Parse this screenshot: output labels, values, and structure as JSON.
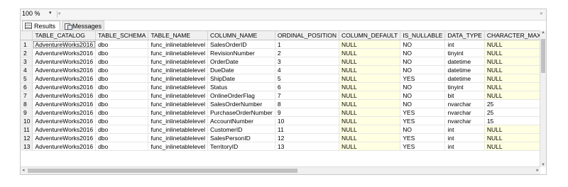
{
  "toolbar": {
    "zoom": "100 %",
    "zoom_arrow": "▾",
    "scroll_left": "◂",
    "scroll_right": "▸"
  },
  "tabs": {
    "results": "Results",
    "messages": "Messages"
  },
  "grid": {
    "headers": [
      "",
      "TABLE_CATALOG",
      "TABLE_SCHEMA",
      "TABLE_NAME",
      "COLUMN_NAME",
      "ORDINAL_POSITION",
      "COLUMN_DEFAULT",
      "IS_NULLABLE",
      "DATA_TYPE",
      "CHARACTER_MAXIM"
    ],
    "rows": [
      [
        "1",
        "AdventureWorks2016",
        "dbo",
        "func_inlinetablelevel",
        "SalesOrderID",
        "1",
        "NULL",
        "NO",
        "int",
        "NULL"
      ],
      [
        "2",
        "AdventureWorks2016",
        "dbo",
        "func_inlinetablelevel",
        "RevisionNumber",
        "2",
        "NULL",
        "NO",
        "tinyint",
        "NULL"
      ],
      [
        "3",
        "AdventureWorks2016",
        "dbo",
        "func_inlinetablelevel",
        "OrderDate",
        "3",
        "NULL",
        "NO",
        "datetime",
        "NULL"
      ],
      [
        "4",
        "AdventureWorks2016",
        "dbo",
        "func_inlinetablelevel",
        "DueDate",
        "4",
        "NULL",
        "NO",
        "datetime",
        "NULL"
      ],
      [
        "5",
        "AdventureWorks2016",
        "dbo",
        "func_inlinetablelevel",
        "ShipDate",
        "5",
        "NULL",
        "YES",
        "datetime",
        "NULL"
      ],
      [
        "6",
        "AdventureWorks2016",
        "dbo",
        "func_inlinetablelevel",
        "Status",
        "6",
        "NULL",
        "NO",
        "tinyint",
        "NULL"
      ],
      [
        "7",
        "AdventureWorks2016",
        "dbo",
        "func_inlinetablelevel",
        "OnlineOrderFlag",
        "7",
        "NULL",
        "NO",
        "bit",
        "NULL"
      ],
      [
        "8",
        "AdventureWorks2016",
        "dbo",
        "func_inlinetablelevel",
        "SalesOrderNumber",
        "8",
        "NULL",
        "NO",
        "nvarchar",
        "25"
      ],
      [
        "9",
        "AdventureWorks2016",
        "dbo",
        "func_inlinetablelevel",
        "PurchaseOrderNumber",
        "9",
        "NULL",
        "YES",
        "nvarchar",
        "25"
      ],
      [
        "10",
        "AdventureWorks2016",
        "dbo",
        "func_inlinetablelevel",
        "AccountNumber",
        "10",
        "NULL",
        "YES",
        "nvarchar",
        "15"
      ],
      [
        "11",
        "AdventureWorks2016",
        "dbo",
        "func_inlinetablelevel",
        "CustomerID",
        "11",
        "NULL",
        "NO",
        "int",
        "NULL"
      ],
      [
        "12",
        "AdventureWorks2016",
        "dbo",
        "func_inlinetablelevel",
        "SalesPersonID",
        "12",
        "NULL",
        "YES",
        "int",
        "NULL"
      ],
      [
        "13",
        "AdventureWorks2016",
        "dbo",
        "func_inlinetablelevel",
        "TerritoryID",
        "13",
        "NULL",
        "YES",
        "int",
        "NULL"
      ]
    ]
  },
  "colors": {
    "null_cell": "#ffffe1",
    "header_bg": "#f0f0f0"
  }
}
